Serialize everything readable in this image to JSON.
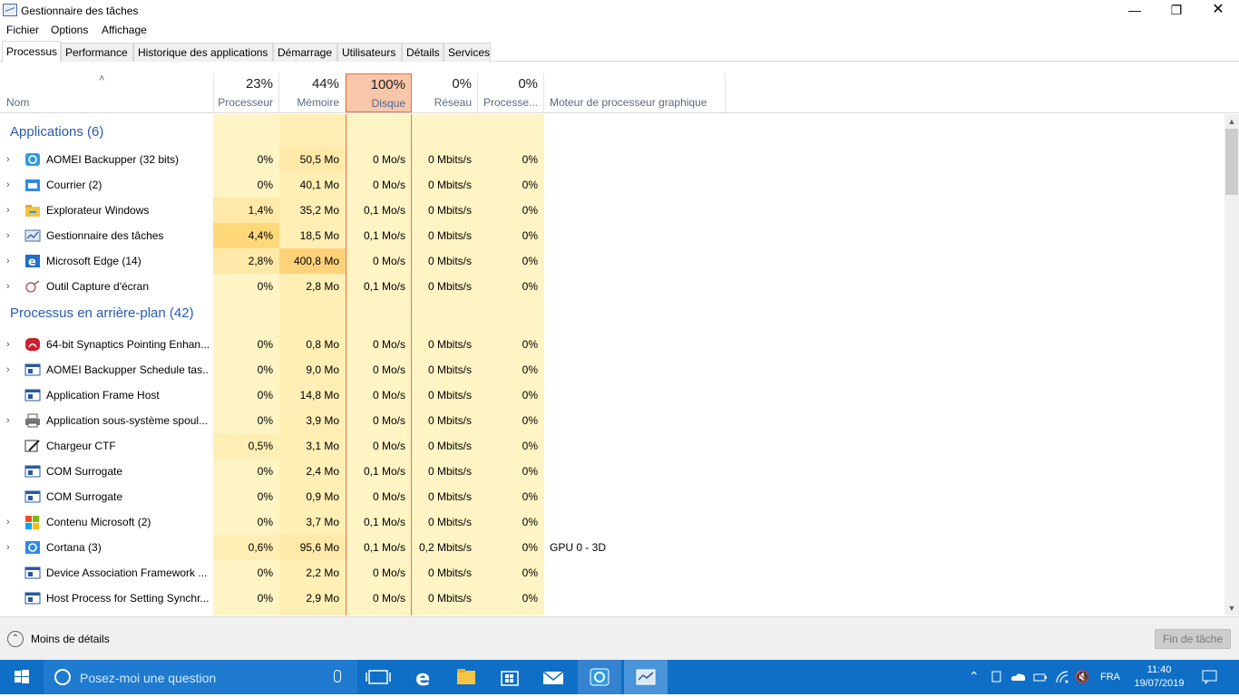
{
  "window": {
    "title": "Gestionnaire des tâches"
  },
  "menu": [
    "Fichier",
    "Options",
    "Affichage"
  ],
  "tabs": [
    "Processus",
    "Performance",
    "Historique des applications",
    "Démarrage",
    "Utilisateurs",
    "Détails",
    "Services"
  ],
  "columns": {
    "name": "Nom",
    "cpu": {
      "pct": "23%",
      "label": "Processeur"
    },
    "mem": {
      "pct": "44%",
      "label": "Mémoire"
    },
    "disk": {
      "pct": "100%",
      "label": "Disque"
    },
    "net": {
      "pct": "0%",
      "label": "Réseau"
    },
    "gpu": {
      "pct": "0%",
      "label": "Processe..."
    },
    "gpu_engine": "Moteur de processeur graphique"
  },
  "groups": {
    "apps": "Applications (6)",
    "background": "Processus en arrière-plan (42)"
  },
  "apps": [
    {
      "name": "AOMEI Backupper (32 bits)",
      "icon": "aomei-icon",
      "cpu": "0%",
      "mem": "50,5 Mo",
      "disk": "0 Mo/s",
      "net": "0 Mbits/s",
      "gpu": "0%"
    },
    {
      "name": "Courrier (2)",
      "icon": "mail-icon",
      "cpu": "0%",
      "mem": "40,1 Mo",
      "disk": "0 Mo/s",
      "net": "0 Mbits/s",
      "gpu": "0%"
    },
    {
      "name": "Explorateur Windows",
      "icon": "folder-icon",
      "cpu": "1,4%",
      "mem": "35,2 Mo",
      "disk": "0,1 Mo/s",
      "net": "0 Mbits/s",
      "gpu": "0%"
    },
    {
      "name": "Gestionnaire des tâches",
      "icon": "taskmgr-icon",
      "cpu": "4,4%",
      "mem": "18,5 Mo",
      "disk": "0,1 Mo/s",
      "net": "0 Mbits/s",
      "gpu": "0%"
    },
    {
      "name": "Microsoft Edge (14)",
      "icon": "edge-icon",
      "cpu": "2,8%",
      "mem": "400,8 Mo",
      "disk": "0 Mo/s",
      "net": "0 Mbits/s",
      "gpu": "0%"
    },
    {
      "name": "Outil Capture d'écran",
      "icon": "snipping-icon",
      "cpu": "0%",
      "mem": "2,8 Mo",
      "disk": "0,1 Mo/s",
      "net": "0 Mbits/s",
      "gpu": "0%"
    }
  ],
  "background": [
    {
      "name": "64-bit Synaptics Pointing Enhan...",
      "icon": "synaptics-icon",
      "expand": true,
      "cpu": "0%",
      "mem": "0,8 Mo",
      "disk": "0 Mo/s",
      "net": "0 Mbits/s",
      "gpu": "0%",
      "engine": ""
    },
    {
      "name": "AOMEI Backupper Schedule tas...",
      "icon": "service-icon",
      "expand": true,
      "cpu": "0%",
      "mem": "9,0 Mo",
      "disk": "0 Mo/s",
      "net": "0 Mbits/s",
      "gpu": "0%",
      "engine": ""
    },
    {
      "name": "Application Frame Host",
      "icon": "service-icon",
      "expand": false,
      "cpu": "0%",
      "mem": "14,8 Mo",
      "disk": "0 Mo/s",
      "net": "0 Mbits/s",
      "gpu": "0%",
      "engine": ""
    },
    {
      "name": "Application sous-système spoul...",
      "icon": "printer-icon",
      "expand": true,
      "cpu": "0%",
      "mem": "3,9 Mo",
      "disk": "0 Mo/s",
      "net": "0 Mbits/s",
      "gpu": "0%",
      "engine": ""
    },
    {
      "name": "Chargeur CTF",
      "icon": "ctf-icon",
      "expand": false,
      "cpu": "0,5%",
      "mem": "3,1 Mo",
      "disk": "0 Mo/s",
      "net": "0 Mbits/s",
      "gpu": "0%",
      "engine": ""
    },
    {
      "name": "COM Surrogate",
      "icon": "service-icon",
      "expand": false,
      "cpu": "0%",
      "mem": "2,4 Mo",
      "disk": "0,1 Mo/s",
      "net": "0 Mbits/s",
      "gpu": "0%",
      "engine": ""
    },
    {
      "name": "COM Surrogate",
      "icon": "service-icon",
      "expand": false,
      "cpu": "0%",
      "mem": "0,9 Mo",
      "disk": "0 Mo/s",
      "net": "0 Mbits/s",
      "gpu": "0%",
      "engine": ""
    },
    {
      "name": "Contenu Microsoft (2)",
      "icon": "microsoft-icon",
      "expand": true,
      "cpu": "0%",
      "mem": "3,7 Mo",
      "disk": "0,1 Mo/s",
      "net": "0 Mbits/s",
      "gpu": "0%",
      "engine": ""
    },
    {
      "name": "Cortana (3)",
      "icon": "cortana-icon",
      "expand": true,
      "cpu": "0,6%",
      "mem": "95,6 Mo",
      "disk": "0,1 Mo/s",
      "net": "0,2 Mbits/s",
      "gpu": "0%",
      "engine": "GPU 0 - 3D"
    },
    {
      "name": "Device Association Framework ...",
      "icon": "service-icon",
      "expand": false,
      "cpu": "0%",
      "mem": "2,2 Mo",
      "disk": "0 Mo/s",
      "net": "0 Mbits/s",
      "gpu": "0%",
      "engine": ""
    },
    {
      "name": "Host Process for Setting Synchr...",
      "icon": "service-icon",
      "expand": false,
      "cpu": "0%",
      "mem": "2,9 Mo",
      "disk": "0 Mo/s",
      "net": "0 Mbits/s",
      "gpu": "0%",
      "engine": ""
    }
  ],
  "footer": {
    "less_details": "Moins de détails",
    "end_task": "Fin de tâche"
  },
  "taskbar": {
    "search_placeholder": "Posez-moi une question",
    "lang": "FRA",
    "time": "11:40",
    "date": "19/07/2019"
  },
  "colors": {
    "accent_blue": "#2a5ab0",
    "disk_hot": "#f8c6a8",
    "heat_light": "#fff4c4",
    "heat_mid": "#ffe9a8",
    "heat_high": "#ffd87a",
    "taskbar": "#0f6fc6"
  }
}
